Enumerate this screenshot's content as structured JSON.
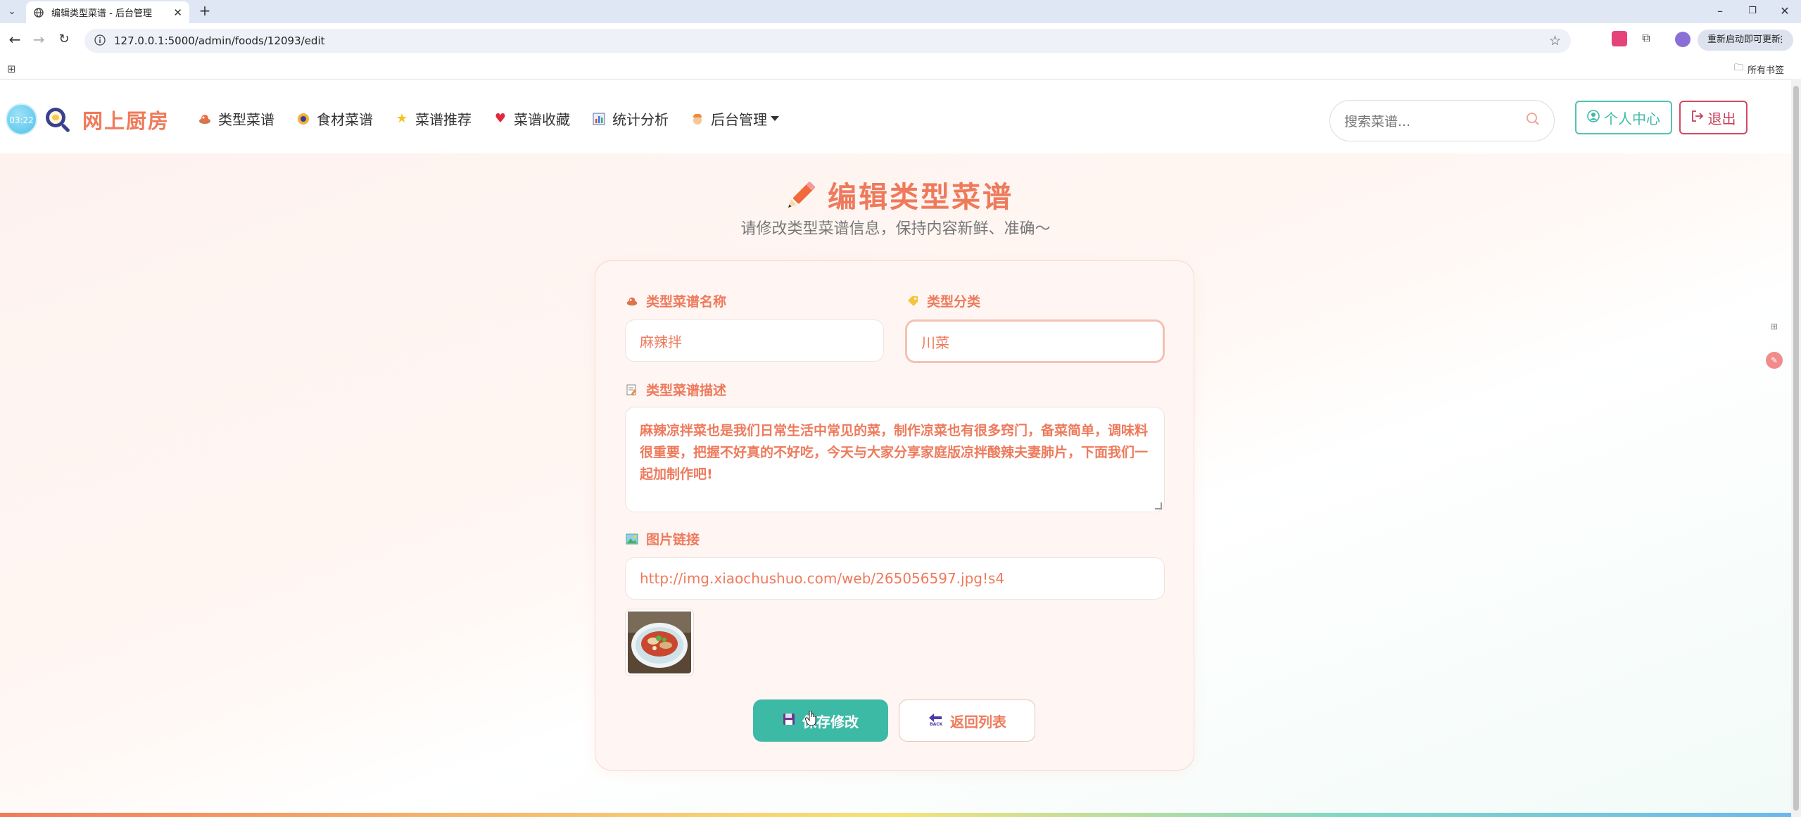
{
  "browser": {
    "tab_title": "编辑类型菜谱 - 后台管理",
    "url": "127.0.0.1:5000/admin/foods/12093/edit",
    "update_button": "重新启动即可更新",
    "bookmarks_all": "所有书签"
  },
  "header": {
    "clock": "03:22",
    "logo_text": "网上厨房",
    "nav": [
      {
        "label": "类型菜谱",
        "icon": "dish-icon"
      },
      {
        "label": "食材菜谱",
        "icon": "ingredient-icon"
      },
      {
        "label": "菜谱推荐",
        "icon": "star-icon"
      },
      {
        "label": "菜谱收藏",
        "icon": "heart-icon"
      },
      {
        "label": "统计分析",
        "icon": "bar-chart-icon"
      },
      {
        "label": "后台管理",
        "icon": "chef-icon"
      }
    ],
    "search_placeholder": "搜索菜谱...",
    "profile_label": "个人中心",
    "logout_label": "退出"
  },
  "page": {
    "title": "编辑类型菜谱",
    "subtitle": "请修改类型菜谱信息，保持内容新鲜、准确～"
  },
  "form": {
    "name_label": "类型菜谱名称",
    "name_value": "麻辣拌",
    "category_label": "类型分类",
    "category_value": "川菜",
    "description_label": "类型菜谱描述",
    "description_value": "麻辣凉拌菜也是我们日常生活中常见的菜，制作凉菜也有很多窍门，备菜简单，调味料很重要，把握不好真的不好吃，今天与大家分享家庭版凉拌酸辣夫妻肺片，下面我们一起加制作吧!",
    "image_label": "图片链接",
    "image_value": "http://img.xiaochushuo.com/web/265056597.jpg!s4",
    "save_label": "保存修改",
    "back_label": "返回列表"
  },
  "colors": {
    "accent": "#ee7a5c",
    "teal": "#3dbaa5",
    "danger": "#c93c57"
  }
}
